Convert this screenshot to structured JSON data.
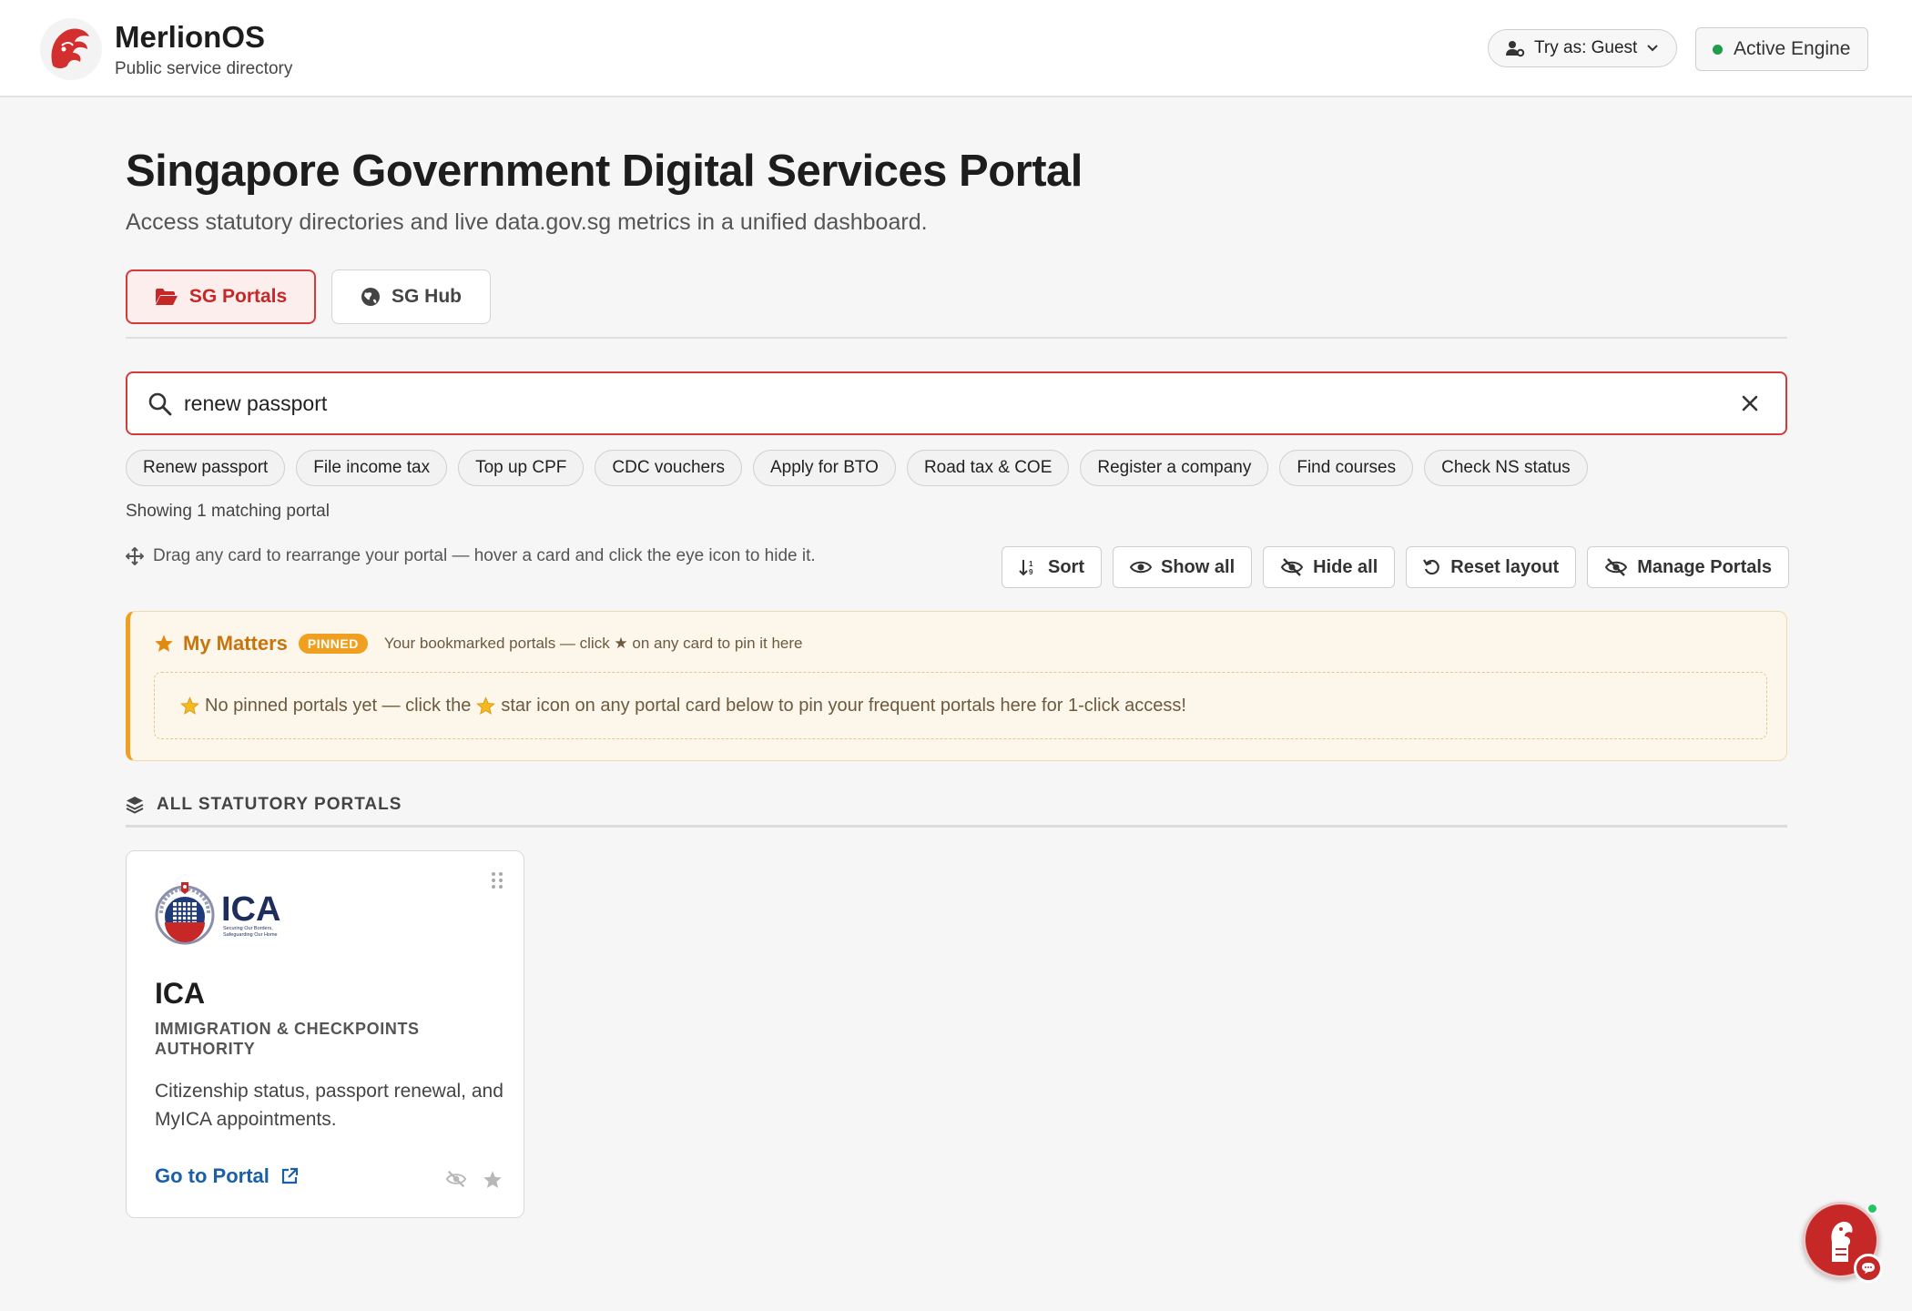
{
  "header": {
    "brand_name": "MerlionOS",
    "brand_subtitle": "Public service directory",
    "try_as_label": "Try as: Guest",
    "engine_label": "Active Engine"
  },
  "hero": {
    "title": "Singapore Government Digital Services Portal",
    "subtitle": "Access statutory directories and live data.gov.sg metrics in a unified dashboard."
  },
  "tabs": [
    {
      "label": "SG Portals",
      "active": true
    },
    {
      "label": "SG Hub",
      "active": false
    }
  ],
  "search": {
    "value": "renew passport"
  },
  "quick_chips": [
    "Renew passport",
    "File income tax",
    "Top up CPF",
    "CDC vouchers",
    "Apply for BTO",
    "Road tax & COE",
    "Register a company",
    "Find courses",
    "Check NS status"
  ],
  "results": {
    "match_count": "Showing 1 matching portal",
    "drag_hint": "Drag any card to rearrange your portal — hover a card and click the eye icon to hide it."
  },
  "toolbar": {
    "sort": "Sort",
    "show_all": "Show all",
    "hide_all": "Hide all",
    "reset_layout": "Reset layout",
    "manage_portals": "Manage Portals"
  },
  "my_matters": {
    "title": "My Matters",
    "badge": "PINNED",
    "note": "Your bookmarked portals — click ★ on any card to pin it here",
    "empty_before": "No pinned portals yet — click the",
    "empty_after": "star icon on any portal card below to pin your frequent portals here for 1-click access!"
  },
  "section": {
    "title": "ALL STATUTORY PORTALS"
  },
  "cards": [
    {
      "logo_text": "ICA",
      "logo_tagline_1": "Securing Our Borders,",
      "logo_tagline_2": "Safeguarding Our Home",
      "abbr": "ICA",
      "full_name": "IMMIGRATION & CHECKPOINTS AUTHORITY",
      "description": "Citizenship status, passport renewal, and MyICA appointments.",
      "link_label": "Go to Portal"
    }
  ],
  "colors": {
    "accent_red": "#c62828",
    "pinned_orange": "#f0a020",
    "link_blue": "#1a5fa8",
    "status_green": "#1f9d4a"
  }
}
